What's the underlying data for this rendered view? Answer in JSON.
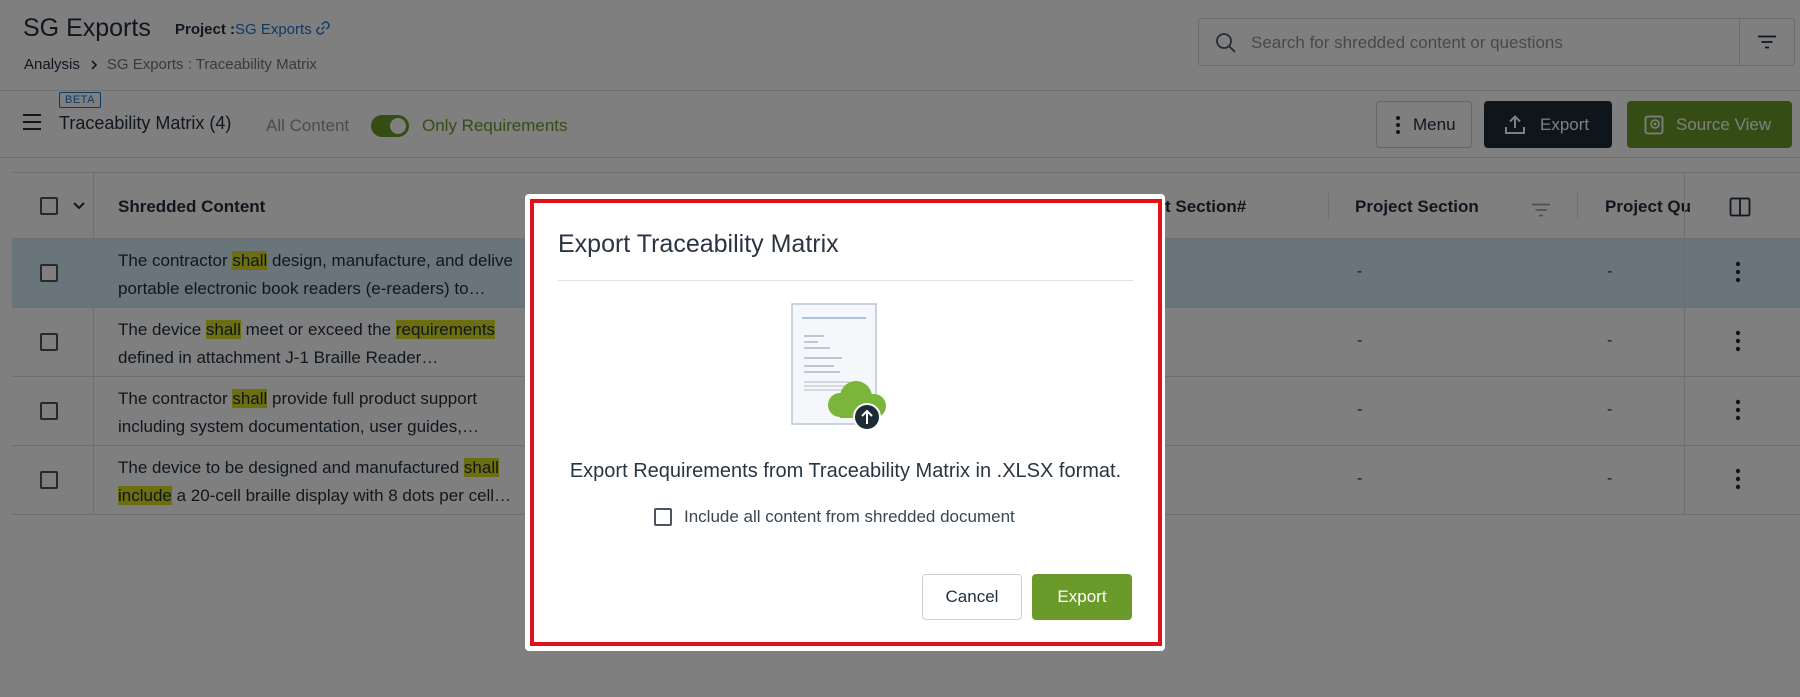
{
  "header": {
    "app_title": "SG Exports",
    "project_label": "Project :",
    "project_name": "SG Exports",
    "breadcrumb": {
      "root": "Analysis",
      "current": "SG Exports : Traceability Matrix"
    },
    "search": {
      "placeholder": "Search for shredded content or questions",
      "value": ""
    }
  },
  "toolbar": {
    "beta_badge": "BETA",
    "title": "Traceability Matrix (4)",
    "toggle_left_label": "All Content",
    "toggle_right_label": "Only Requirements",
    "toggle_on": true,
    "menu_label": "Menu",
    "export_label": "Export",
    "source_view_label": "Source View"
  },
  "table": {
    "columns": {
      "shredded_content": "Shredded Content",
      "project_section_num": "t Section#",
      "project_section": "Project Section",
      "project_question": "Project Qu"
    },
    "rows": [
      {
        "selected": true,
        "line1_a": "The contractor ",
        "line1_hl": "shall",
        "line1_b": " design, manufacture, and delive",
        "line2": "portable electronic book readers (e-readers) to…",
        "section": "-",
        "question": "-"
      },
      {
        "selected": false,
        "line1_a": "The device ",
        "line1_hl": "shall",
        "line1_b": " meet or exceed the ",
        "line1_hl2": "requirements",
        "line2": "defined in attachment J-1 Braille Reader…",
        "section": "-",
        "question": "-"
      },
      {
        "selected": false,
        "line1_a": "The contractor ",
        "line1_hl": "shall",
        "line1_b": " provide full product support",
        "line2": "including system documentation, user guides,…",
        "section": "-",
        "question": "-"
      },
      {
        "selected": false,
        "line1_a": "The device to be designed and manufactured ",
        "line1_hl": "shall",
        "line2_hl": "include",
        "line2": " a 20-cell braille display with 8 dots per cell…",
        "section": "-",
        "question": "-"
      }
    ]
  },
  "modal": {
    "title": "Export Traceability Matrix",
    "description": "Export Requirements from Traceability Matrix in .XLSX format.",
    "include_label": "Include all content from shredded document",
    "include_checked": false,
    "cancel_label": "Cancel",
    "export_label": "Export"
  },
  "colors": {
    "accent_green": "#6a9a2a",
    "dark_navy": "#1d2b36",
    "link_blue": "#1a73c8",
    "highlight_yellow": "#d8dd20",
    "focus_red": "#e1111a"
  }
}
